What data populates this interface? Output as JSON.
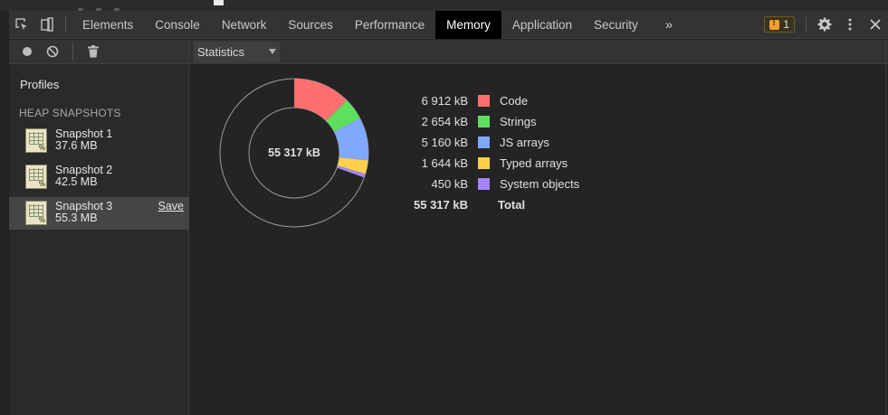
{
  "tabs": [
    "Elements",
    "Console",
    "Network",
    "Sources",
    "Performance",
    "Memory",
    "Application",
    "Security"
  ],
  "active_tab": "Memory",
  "overflow_label": "»",
  "issues_count": "1",
  "view_select": "Statistics",
  "sidebar": {
    "title": "Profiles",
    "section": "HEAP SNAPSHOTS",
    "snapshots": [
      {
        "name": "Snapshot 1",
        "size": "37.6 MB"
      },
      {
        "name": "Snapshot 2",
        "size": "42.5 MB"
      },
      {
        "name": "Snapshot 3",
        "size": "55.3 MB",
        "action": "Save"
      }
    ]
  },
  "chart_data": {
    "type": "pie",
    "center_label": "55 317 kB",
    "slices": [
      {
        "label": "Code",
        "value_text": "6 912 kB",
        "value": 6912,
        "color": "#ff6f6f"
      },
      {
        "label": "Strings",
        "value_text": "2 654 kB",
        "value": 2654,
        "color": "#5ee05e"
      },
      {
        "label": "JS arrays",
        "value_text": "5 160 kB",
        "value": 5160,
        "color": "#80a8ff"
      },
      {
        "label": "Typed arrays",
        "value_text": "1 644 kB",
        "value": 1644,
        "color": "#ffd04c"
      },
      {
        "label": "System objects",
        "value_text": "450 kB",
        "value": 450,
        "color": "#a585f7"
      }
    ],
    "total": {
      "label": "Total",
      "value_text": "55 317 kB",
      "value": 55317
    }
  }
}
